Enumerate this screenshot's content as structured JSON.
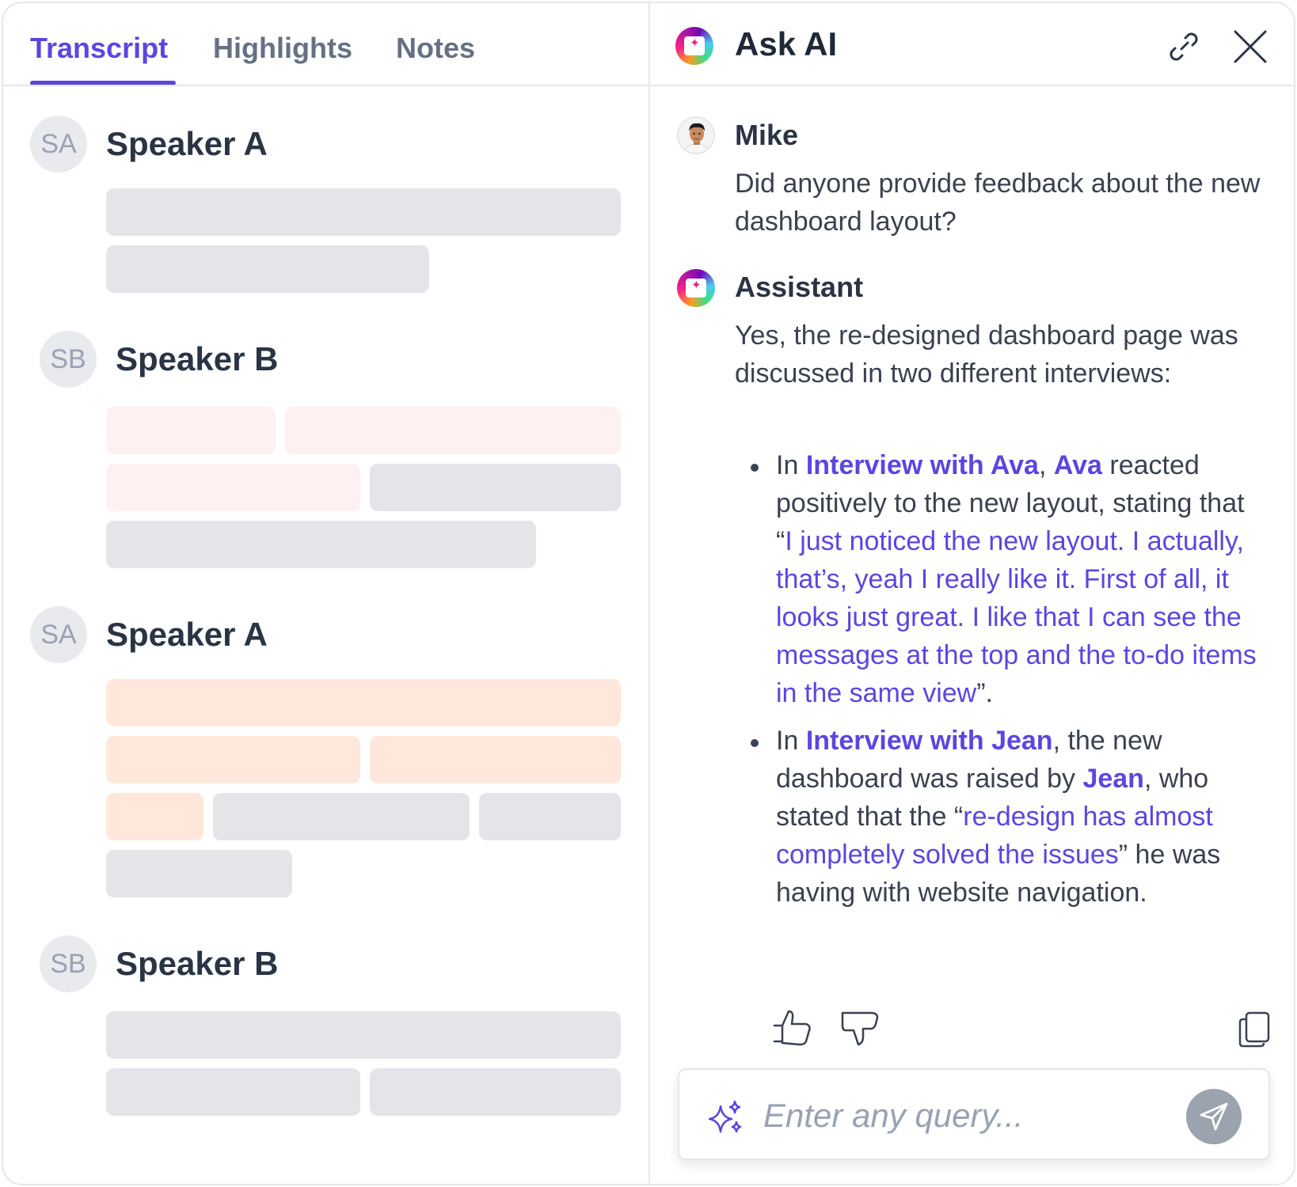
{
  "tabs": [
    {
      "label": "Transcript",
      "active": true
    },
    {
      "label": "Highlights",
      "active": false
    },
    {
      "label": "Notes",
      "active": false
    }
  ],
  "transcript": [
    {
      "initials": "SA",
      "name": "Speaker A"
    },
    {
      "initials": "SB",
      "name": "Speaker B"
    },
    {
      "initials": "SA",
      "name": "Speaker A"
    },
    {
      "initials": "SB",
      "name": "Speaker B"
    }
  ],
  "ask_ai": {
    "title": "Ask AI",
    "user": {
      "name": "Mike",
      "message": "Did anyone provide feedback about the new dashboard layout?"
    },
    "assistant": {
      "name": "Assistant",
      "intro": "Yes, the re-designed dashboard page was discussed in two different interviews:",
      "bullets": [
        {
          "prefix": "In ",
          "link": "Interview with Ava",
          "mid": ", ",
          "person": "Ava",
          "text": " reacted positively to the new layout, stating that “",
          "quote": "I just noticed the new layout. I actually, that’s, yeah I really like it. First of all, it looks just great. I like that I can see the messages at the top and the to-do items in the same view",
          "end": "”."
        },
        {
          "prefix": "In ",
          "link": "Interview with Jean",
          "mid": ", the new dashboard was raised by ",
          "person": "Jean",
          "text": ", who stated that the “",
          "quote": "re-design has almost completely solved the issues",
          "end": "” he was having with website navigation."
        }
      ]
    },
    "query_placeholder": "Enter any query..."
  },
  "colors": {
    "accent": "#5b46e0",
    "bar_gray": "#e4e5e9",
    "bar_pink": "#fff0f1",
    "bar_peach": "#ffe8db"
  }
}
